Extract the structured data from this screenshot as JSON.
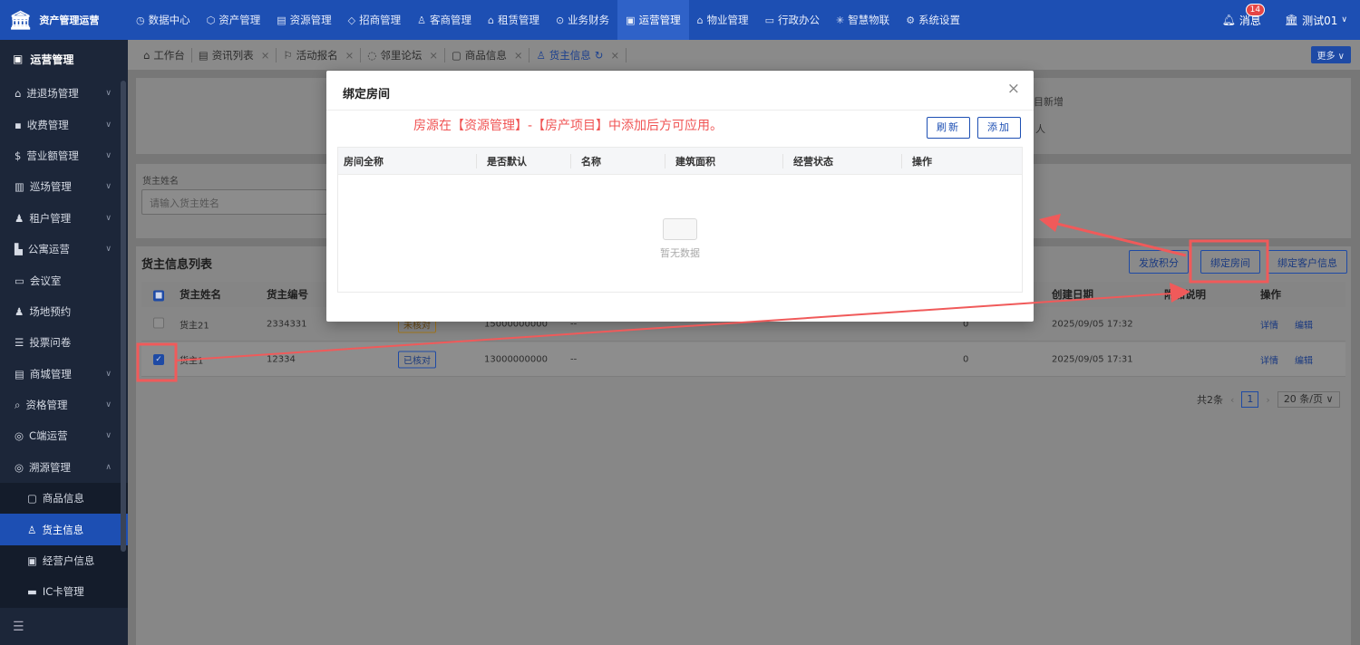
{
  "app": {
    "name": "资产管理运营"
  },
  "topnav": [
    {
      "label": "数据中心",
      "icon": "clock-icon"
    },
    {
      "label": "资产管理",
      "icon": "cube-icon"
    },
    {
      "label": "资源管理",
      "icon": "building-icon"
    },
    {
      "label": "招商管理",
      "icon": "tag-icon"
    },
    {
      "label": "客商管理",
      "icon": "users-icon"
    },
    {
      "label": "租赁管理",
      "icon": "house-icon"
    },
    {
      "label": "业务财务",
      "icon": "coin-icon"
    },
    {
      "label": "运营管理",
      "icon": "chart-icon",
      "active": true
    },
    {
      "label": "物业管理",
      "icon": "home-icon"
    },
    {
      "label": "行政办公",
      "icon": "monitor-icon"
    },
    {
      "label": "智慧物联",
      "icon": "sun-icon"
    },
    {
      "label": "系统设置",
      "icon": "gear-icon"
    }
  ],
  "header": {
    "messages_label": "消息",
    "messages_count": "14",
    "user": "测试01"
  },
  "sidebar": {
    "title": "运营管理",
    "items": [
      {
        "label": "进退场管理"
      },
      {
        "label": "收费管理"
      },
      {
        "label": "营业额管理"
      },
      {
        "label": "巡场管理"
      },
      {
        "label": "租户管理"
      },
      {
        "label": "公寓运营"
      },
      {
        "label": "会议室"
      },
      {
        "label": "场地预约"
      },
      {
        "label": "投票问卷"
      },
      {
        "label": "商城管理"
      },
      {
        "label": "资格管理"
      },
      {
        "label": "C端运营"
      },
      {
        "label": "溯源管理"
      }
    ],
    "subitems": [
      {
        "label": "商品信息"
      },
      {
        "label": "货主信息",
        "active": true
      },
      {
        "label": "经营户信息"
      },
      {
        "label": "IC卡管理"
      }
    ]
  },
  "tabs": [
    {
      "label": "工作台"
    },
    {
      "label": "资讯列表"
    },
    {
      "label": "活动报名"
    },
    {
      "label": "邻里论坛"
    },
    {
      "label": "商品信息"
    },
    {
      "label": "货主信息",
      "active": true
    }
  ],
  "more_label": "更多",
  "bg_fragments": {
    "frag1": "目新增",
    "frag2": "人"
  },
  "filter": {
    "label": "货主姓名",
    "placeholder": "请输入货主姓名"
  },
  "list": {
    "title": "货主信息列表",
    "actions": {
      "points": "发放积分",
      "bind_room": "绑定房间",
      "bind_customer": "绑定客户信息"
    },
    "columns": {
      "name": "货主姓名",
      "code": "货主编号",
      "created": "创建日期",
      "note": "附加说明",
      "ops": "操作"
    },
    "rows": [
      {
        "name": "货主21",
        "code": "2334331",
        "status": "未核对",
        "phone": "15000000000",
        "dash": "--",
        "num": "0",
        "created": "2025/09/05 17:32",
        "detail": "详情",
        "edit": "编辑"
      },
      {
        "name": "货主1",
        "code": "12334",
        "status": "已核对",
        "phone": "13000000000",
        "dash": "--",
        "num": "0",
        "created": "2025/09/05 17:31",
        "detail": "详情",
        "edit": "编辑"
      }
    ]
  },
  "pagination": {
    "total": "共2条",
    "page": "1",
    "page_size": "20 条/页"
  },
  "modal": {
    "title": "绑定房间",
    "tip": "房源在【资源管理】-【房产项目】中添加后方可应用。",
    "refresh": "刷新",
    "add": "添加",
    "columns": [
      "房间全称",
      "是否默认",
      "名称",
      "建筑面积",
      "经营状态",
      "操作"
    ],
    "empty": "暂无数据"
  },
  "colors": {
    "topbar": "#1d4fb3",
    "sidebar": "#1c2639",
    "accent": "#1d4fb3",
    "annotation": "#f05a5a",
    "tip": "#f05454"
  }
}
